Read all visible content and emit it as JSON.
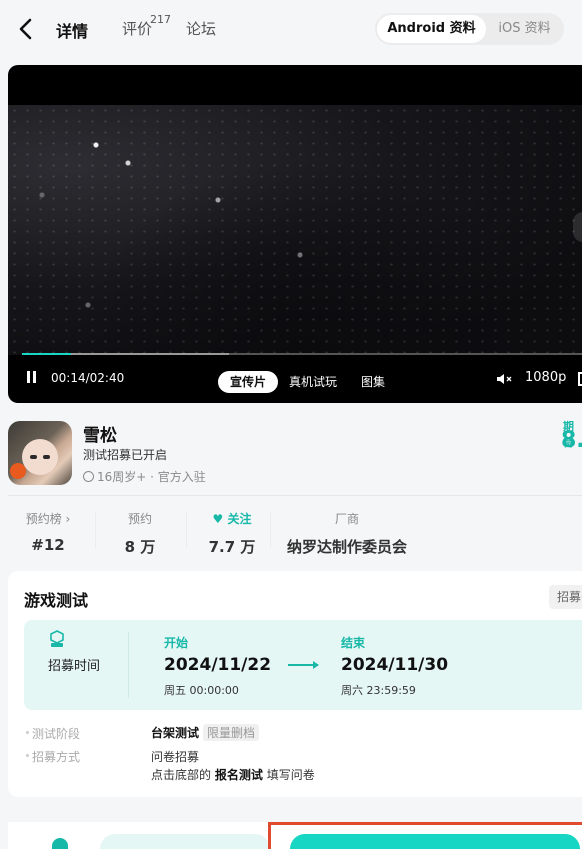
{
  "header": {
    "tabs": [
      {
        "label": "详情"
      },
      {
        "label": "评价",
        "count": "217"
      },
      {
        "label": "论坛"
      }
    ],
    "platform": {
      "android": "Android 资料",
      "ios": "iOS 资料"
    }
  },
  "video": {
    "time": "00:14/02:40",
    "progress_fraction": 0.0875,
    "buffer_fraction": 0.37,
    "tabs": [
      "宣传片",
      "真机试玩",
      "图集"
    ],
    "resolution": "1080p"
  },
  "game": {
    "name": "雪松",
    "status": "测试招募已开启",
    "meta": "16周岁+ · 官方入驻",
    "rating_label": "期待",
    "rating_value": "8."
  },
  "stats": [
    {
      "label": "预约榜 ›",
      "value": "#12"
    },
    {
      "label": "预约",
      "value": "8 万"
    },
    {
      "label": "关注",
      "value": "7.7 万"
    },
    {
      "label": "厂商",
      "value": "纳罗达制作委员会"
    }
  ],
  "test": {
    "title": "游戏测试",
    "tag": "招募中",
    "period_label": "招募时间",
    "start_label": "开始",
    "start_date": "2024/11/22",
    "start_time": "周五 00:00:00",
    "end_label": "结束",
    "end_date": "2024/11/30",
    "end_time": "周六 23:59:59",
    "stage_label": "测试阶段",
    "stage_value": "台架测试",
    "stage_chip": "限量删档",
    "method_label": "招募方式",
    "method_value": "问卷招募",
    "method_hint_a": "点击底部的",
    "method_hint_b": "报名测试",
    "method_hint_c": "填写问卷"
  },
  "colors": {
    "accent": "#17d6c4",
    "accent_text": "#17b8a8",
    "highlight_frame": "#e04a2f"
  }
}
